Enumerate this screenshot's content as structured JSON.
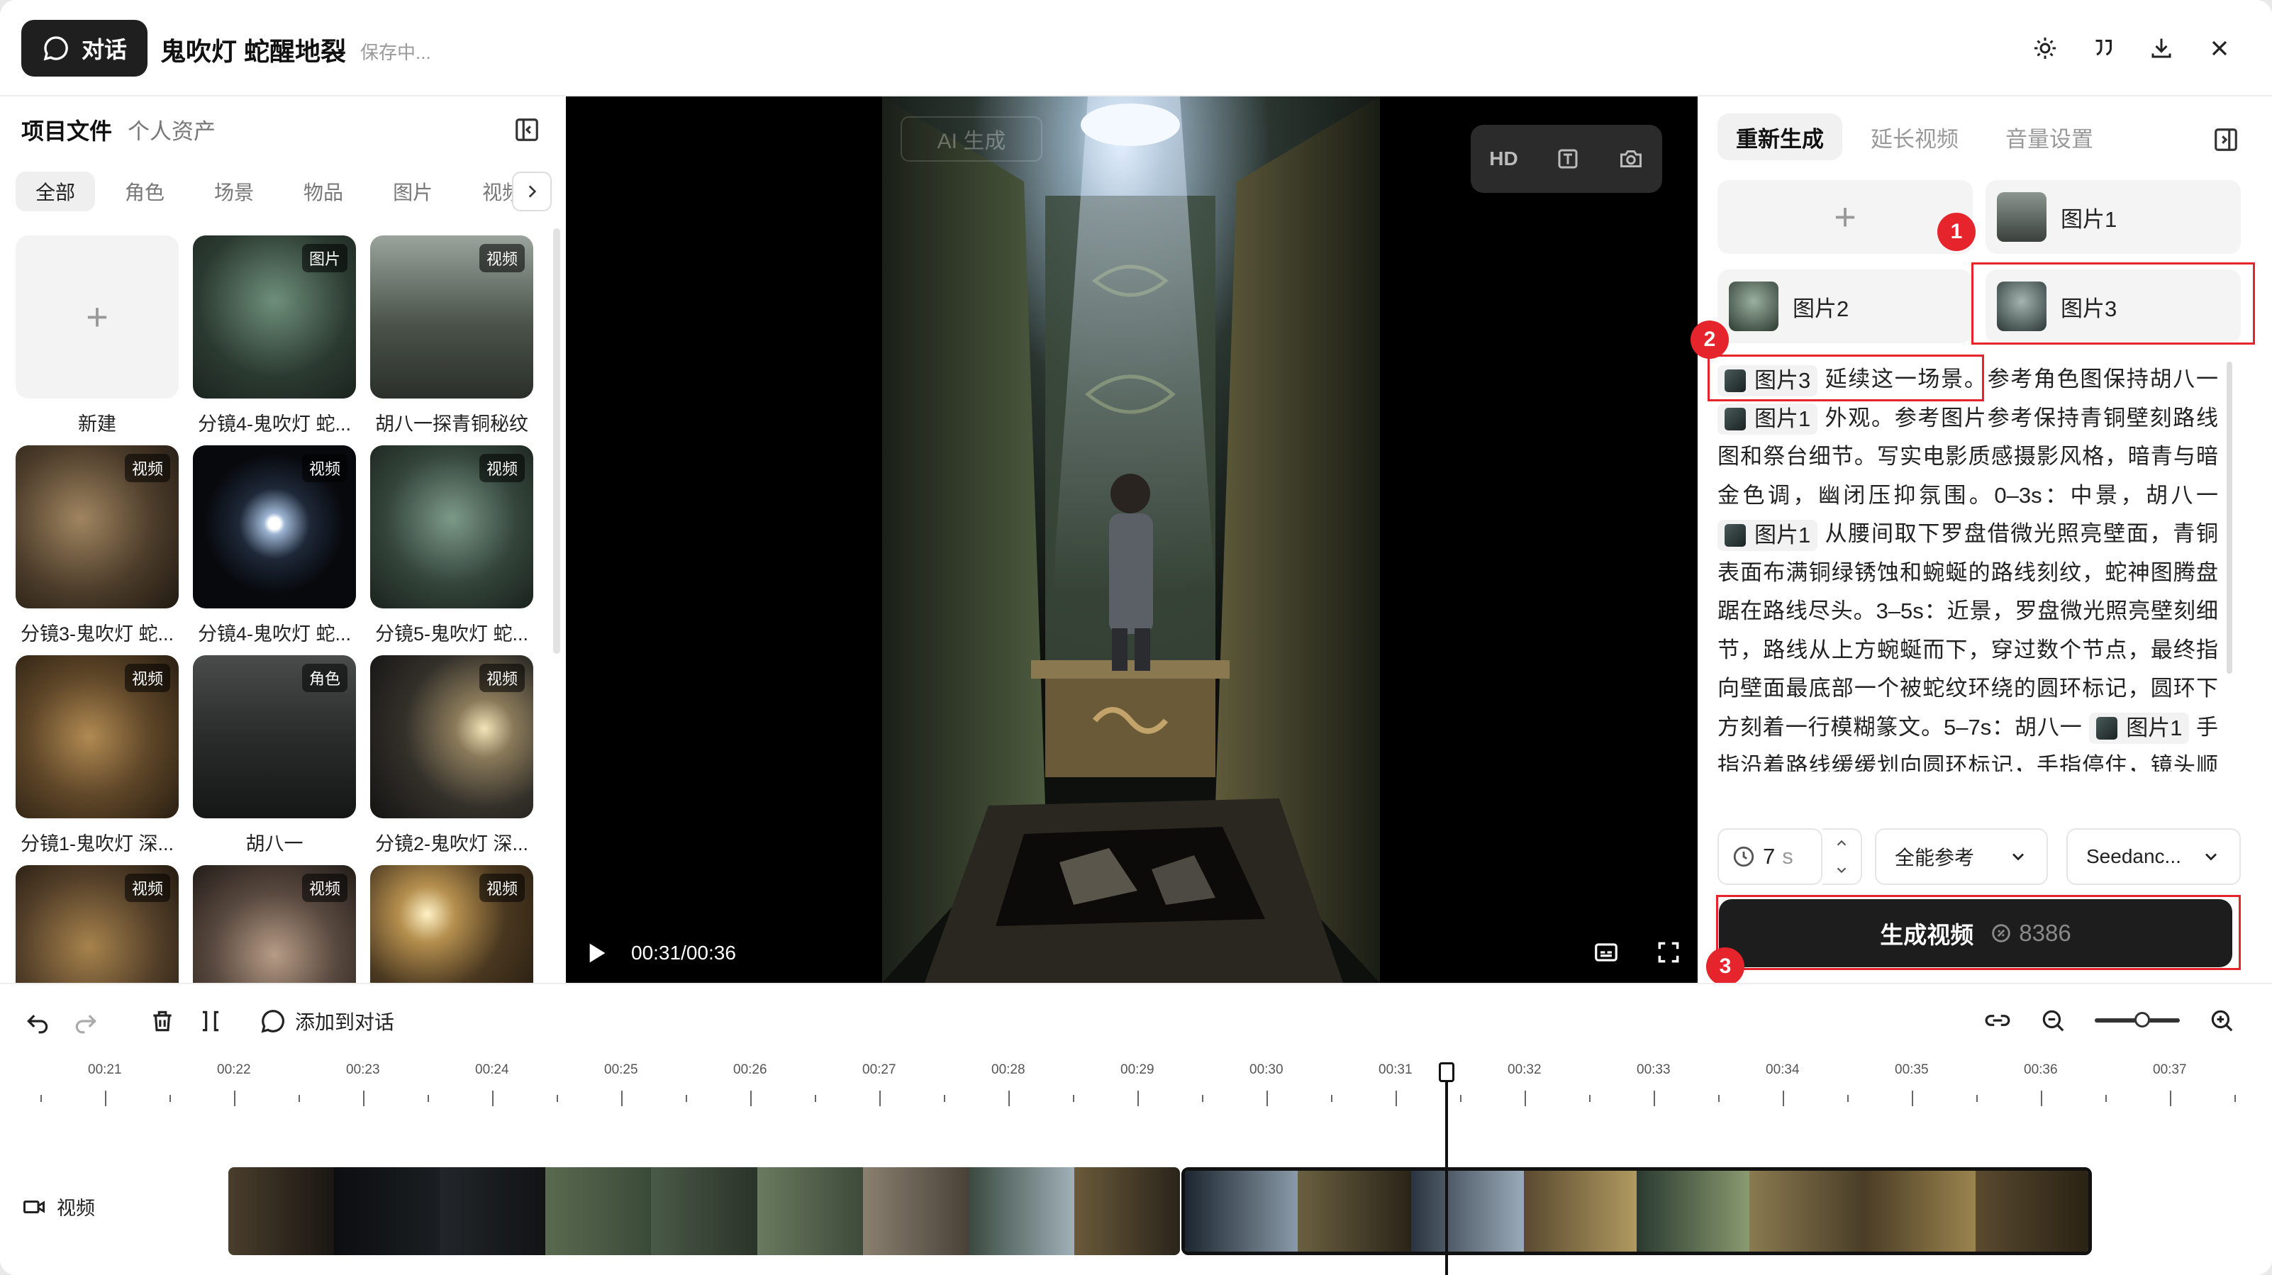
{
  "header": {
    "chat_label": "对话",
    "title": "鬼吹灯 蛇醒地裂",
    "status": "保存中..."
  },
  "left": {
    "title": "项目文件",
    "subtitle": "个人资产",
    "filters": [
      "全部",
      "角色",
      "场景",
      "物品",
      "图片",
      "视频"
    ],
    "new_label": "新建",
    "assets": [
      {
        "caption": "分镜4-鬼吹灯 蛇...",
        "tag": "图片"
      },
      {
        "caption": "胡八一探青铜秘纹",
        "tag": "视频"
      },
      {
        "caption": "分镜3-鬼吹灯 蛇...",
        "tag": "视频"
      },
      {
        "caption": "分镜4-鬼吹灯 蛇...",
        "tag": "视频"
      },
      {
        "caption": "分镜5-鬼吹灯 蛇...",
        "tag": "视频"
      },
      {
        "caption": "分镜1-鬼吹灯 深...",
        "tag": "视频"
      },
      {
        "caption": "胡八一",
        "tag": "角色"
      },
      {
        "caption": "分镜2-鬼吹灯 深...",
        "tag": "视频"
      },
      {
        "caption": "",
        "tag": "视频"
      },
      {
        "caption": "",
        "tag": "视频"
      },
      {
        "caption": "",
        "tag": "视频"
      }
    ]
  },
  "player": {
    "watermark": "AI 生成",
    "hd": "HD",
    "time": "00:31/00:36"
  },
  "right": {
    "tabs": [
      "重新生成",
      "延长视频",
      "音量设置"
    ],
    "refs": [
      "图片1",
      "图片2",
      "图片3"
    ],
    "badges": [
      "1",
      "2",
      "3"
    ],
    "prompt": {
      "chip3": "图片3",
      "p1": "延续这一场景。",
      "p2": "参考角色图保持胡八一",
      "chip1a": "图片1",
      "p3": "外观。参考图片参考保持青铜壁刻路线图和祭台细节。写实电影质感摄影风格，暗青与暗金色调，幽闭压抑氛围。0–3s：中景，胡八一",
      "chip1b": "图片1",
      "p4": "从腰间取下罗盘借微光照亮壁面，青铜表面布满铜绿锈蚀和蜿蜒的路线刻纹，蛇神图腾盘踞在路线尽头。3–5s：近景，罗盘微光照亮壁刻细节，路线从上方蜿蜒而下，穿过数个节点，最终指向壁面最底部一个被蛇纹环绕的圆环标记，圆环下方刻着一行模糊篆文。5–7s：胡八一",
      "chip1c": "图片1",
      "p5": "手指沿着路线缓缓划向圆环标记，手指停住，镜头顺着他的视线推向圆环——圆环深处，容容尽头黑"
    },
    "duration": "7",
    "duration_unit": "s",
    "mode": "全能参考",
    "model": "Seedanc...",
    "generate_label": "生成视频",
    "cost": "8386"
  },
  "timeline": {
    "add_to_chat": "添加到对话",
    "ticks": [
      "00:21",
      "00:22",
      "00:23",
      "00:24",
      "00:25",
      "00:26",
      "00:27",
      "00:28",
      "00:29",
      "00:30",
      "00:31",
      "00:32",
      "00:33",
      "00:34",
      "00:35",
      "00:36",
      "00:37"
    ],
    "track_label": "视频"
  }
}
